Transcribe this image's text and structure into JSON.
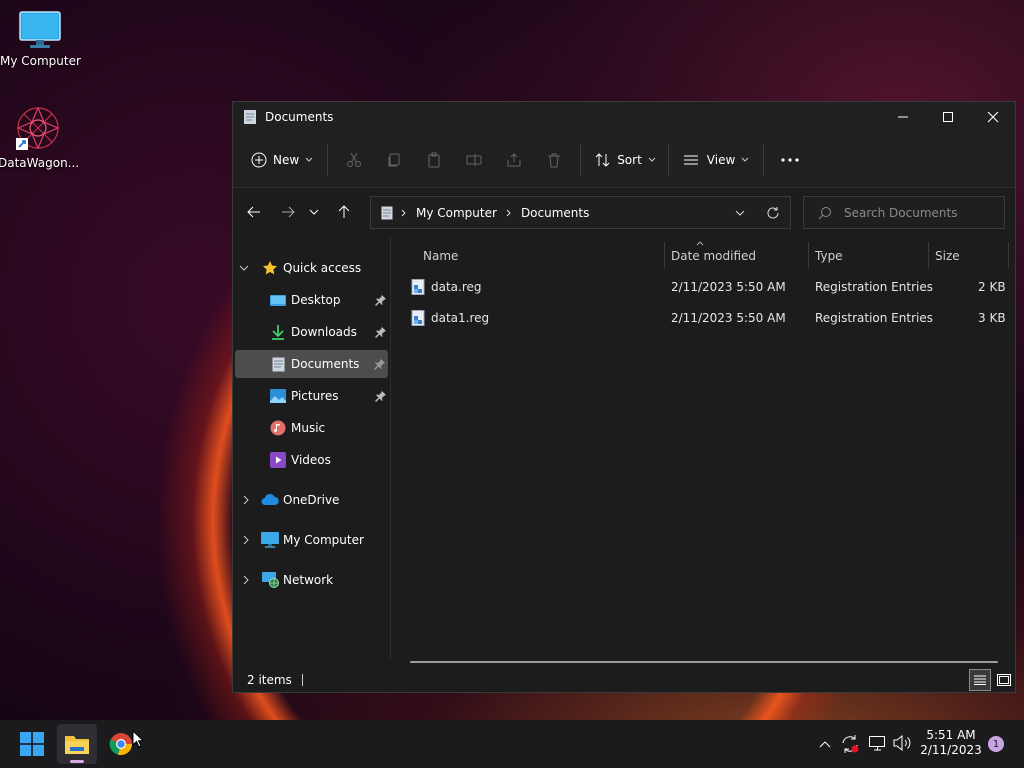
{
  "desktop": {
    "icons": [
      {
        "label": "My Computer",
        "icon": "monitor-icon"
      },
      {
        "label": "DataWagon...",
        "icon": "datawagon-app-icon"
      }
    ]
  },
  "window": {
    "title": "Documents",
    "toolbar": {
      "new_label": "New",
      "sort_label": "Sort",
      "view_label": "View"
    },
    "address": {
      "parts": [
        "My Computer",
        "Documents"
      ]
    },
    "search": {
      "placeholder": "Search Documents"
    },
    "sidebar": {
      "quick_access": "Quick access",
      "items": [
        {
          "label": "Desktop",
          "icon": "desktop-folder-icon",
          "pinned": true
        },
        {
          "label": "Downloads",
          "icon": "download-icon",
          "pinned": true
        },
        {
          "label": "Documents",
          "icon": "document-icon",
          "pinned": true,
          "selected": true
        },
        {
          "label": "Pictures",
          "icon": "pictures-icon",
          "pinned": true
        },
        {
          "label": "Music",
          "icon": "music-icon",
          "pinned": false
        },
        {
          "label": "Videos",
          "icon": "videos-icon",
          "pinned": false
        }
      ],
      "roots": [
        {
          "label": "OneDrive",
          "icon": "cloud-icon"
        },
        {
          "label": "My Computer",
          "icon": "computer-icon"
        },
        {
          "label": "Network",
          "icon": "network-icon"
        }
      ]
    },
    "columns": {
      "name": "Name",
      "date": "Date modified",
      "type": "Type",
      "size": "Size"
    },
    "files": [
      {
        "name": "data.reg",
        "date": "2/11/2023 5:50 AM",
        "type": "Registration Entries",
        "size": "2 KB"
      },
      {
        "name": "data1.reg",
        "date": "2/11/2023 5:50 AM",
        "type": "Registration Entries",
        "size": "3 KB"
      }
    ],
    "status": {
      "items_count": "2 items"
    }
  },
  "taskbar": {
    "time": "5:51 AM",
    "date": "2/11/2023",
    "notification_count": "1"
  },
  "colors": {
    "accent": "#0078d4",
    "window_bg": "#1c1c1c",
    "selected_bg": "#4d4d4d"
  }
}
